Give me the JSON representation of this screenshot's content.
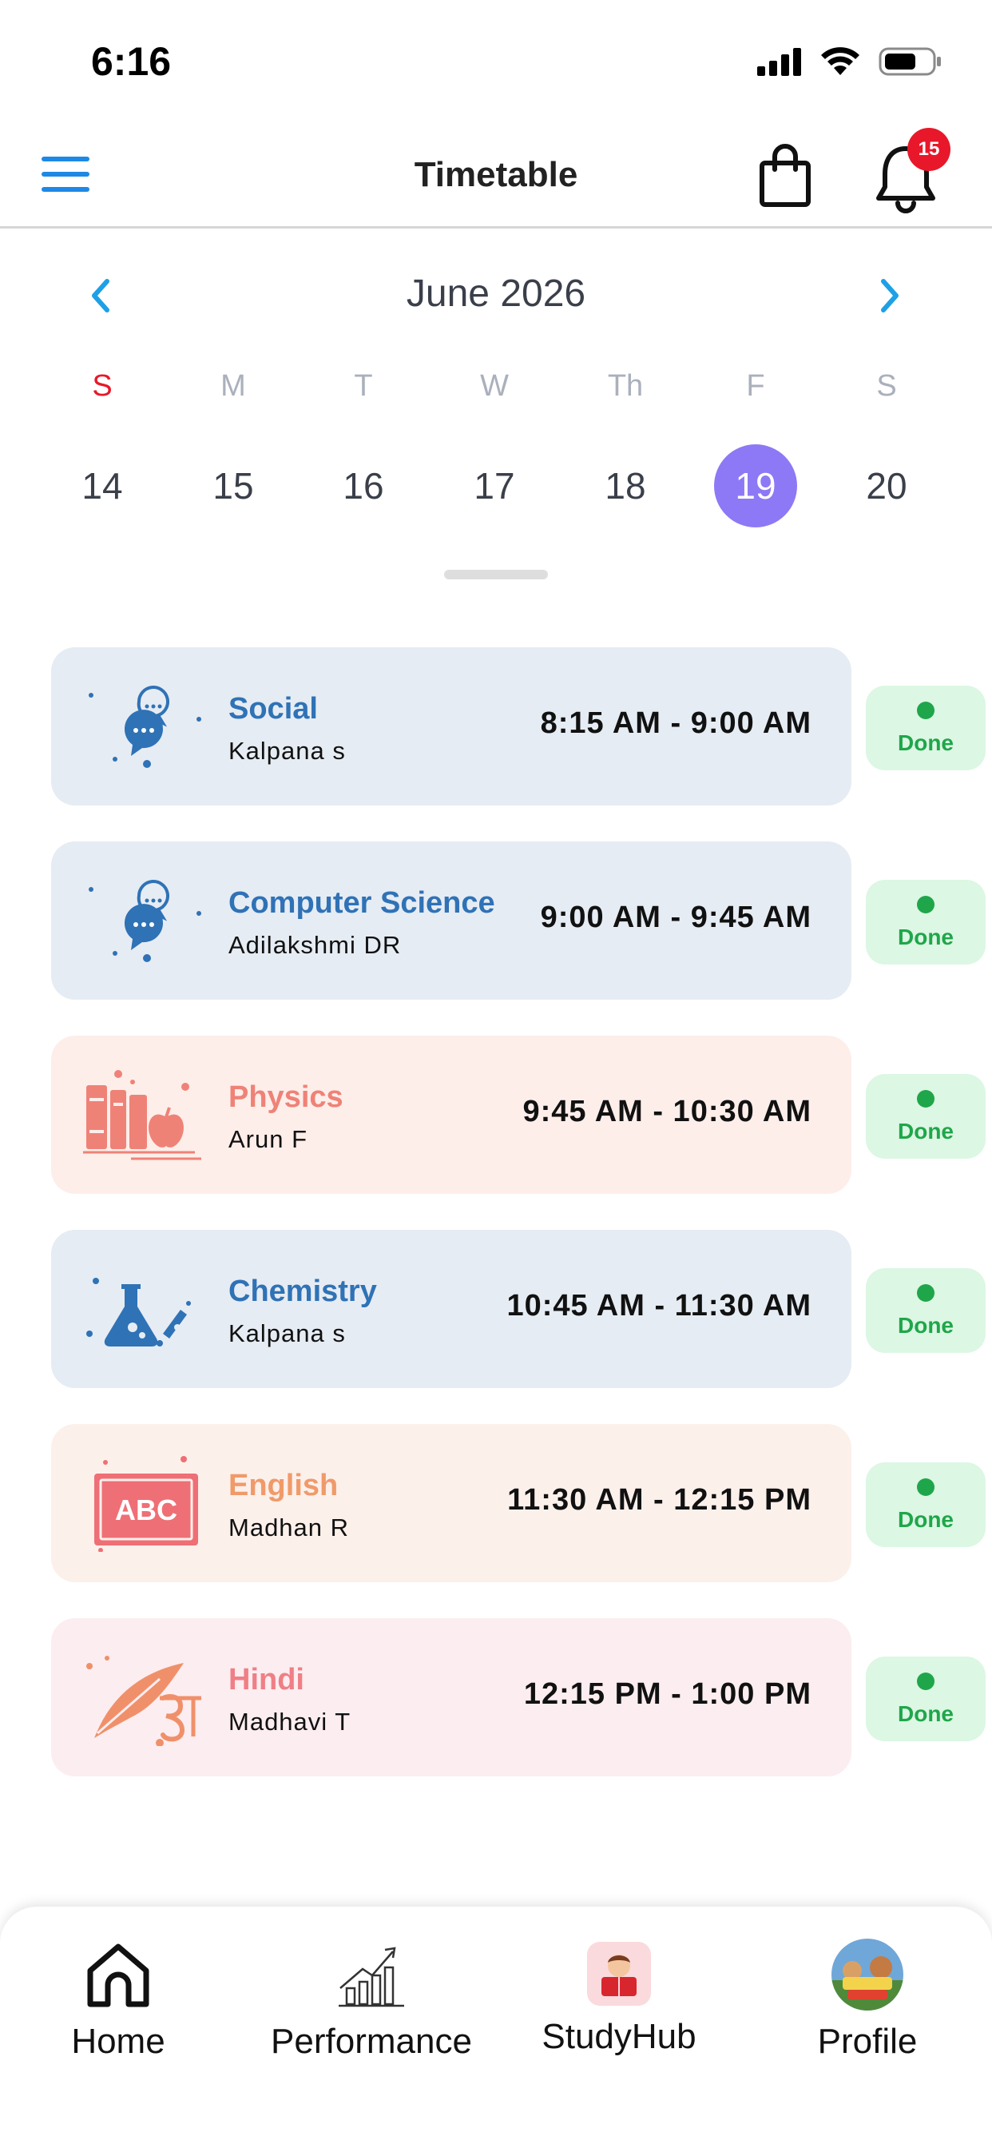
{
  "status_bar": {
    "time": "6:16"
  },
  "header": {
    "title": "Timetable",
    "notification_count": "15"
  },
  "calendar": {
    "month_label": "June 2026",
    "weekdays": [
      "S",
      "M",
      "T",
      "W",
      "Th",
      "F",
      "S"
    ],
    "dates": [
      "14",
      "15",
      "16",
      "17",
      "18",
      "19",
      "20"
    ],
    "selected_date": "19"
  },
  "schedule": [
    {
      "subject": "Social",
      "teacher": "Kalpana s",
      "time": "8:15 AM - 9:00 AM",
      "status": "Done",
      "theme": "blue",
      "subject_color": "#2f72b6",
      "icon": "chat-bubbles-icon"
    },
    {
      "subject": "Computer Science",
      "teacher": "Adilakshmi DR",
      "time": "9:00 AM - 9:45 AM",
      "status": "Done",
      "theme": "blue",
      "subject_color": "#2f72b6",
      "icon": "chat-bubbles-icon"
    },
    {
      "subject": "Physics",
      "teacher": "Arun F",
      "time": "9:45 AM - 10:30 AM",
      "status": "Done",
      "theme": "peach",
      "subject_color": "#ef8277",
      "icon": "books-apple-icon"
    },
    {
      "subject": "Chemistry",
      "teacher": "Kalpana s",
      "time": "10:45 AM - 11:30 AM",
      "status": "Done",
      "theme": "blue",
      "subject_color": "#2f72b6",
      "icon": "flask-icon"
    },
    {
      "subject": "English",
      "teacher": "Madhan R",
      "time": "11:30 AM - 12:15 PM",
      "status": "Done",
      "theme": "cream",
      "subject_color": "#f09a6a",
      "icon": "abc-board-icon"
    },
    {
      "subject": "Hindi",
      "teacher": "Madhavi T",
      "time": "12:15 PM - 1:00 PM",
      "status": "Done",
      "theme": "pink",
      "subject_color": "#ef7f86",
      "icon": "quill-hindi-icon"
    }
  ],
  "bottom_nav": [
    {
      "label": "Home",
      "icon": "home-icon"
    },
    {
      "label": "Performance",
      "icon": "growth-chart-icon"
    },
    {
      "label": "StudyHub",
      "icon": "reader-icon"
    },
    {
      "label": "Profile",
      "icon": "avatar"
    }
  ],
  "colors": {
    "accent_blue": "#1e88e5",
    "selected_date": "#8d79f5",
    "sunday_red": "#e8182a",
    "done_green": "#1fa64a",
    "done_bg": "#dcf7e3"
  }
}
